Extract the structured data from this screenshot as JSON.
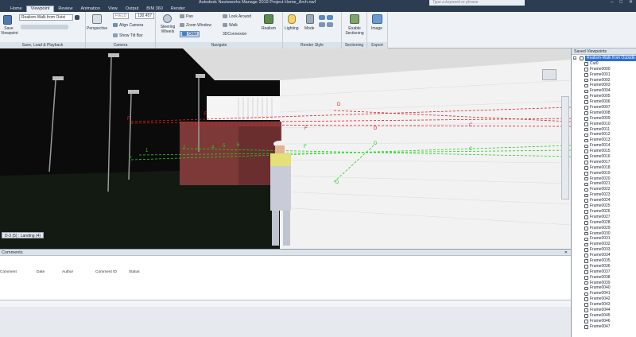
{
  "app": {
    "title": "Autodesk Navisworks Manage 2019    Project Home_Arch.nwf",
    "search_placeholder": "Type a keyword or phrase",
    "window_controls": [
      "–",
      "□",
      "✕"
    ]
  },
  "tabs": [
    "Home",
    "Viewpoint",
    "Review",
    "Animation",
    "View",
    "Output",
    "BIM 360",
    "Render"
  ],
  "active_tab": "Viewpoint",
  "ribbon": {
    "save_load": {
      "save_label": "Save\nViewpoint",
      "viewpoint_combo": "Realism-Walk from Outsi",
      "panel_title": "Save, Load & Playback"
    },
    "camera": {
      "perspective_label": "Perspective",
      "fov_value": "130.457",
      "fov_combo": "FIELD",
      "align_camera": "Align Camera",
      "show_tilt_bar": "Show Tilt Bar",
      "panel_title": "Camera"
    },
    "navigate": {
      "steering_wheels": "Steering\nWheels",
      "pan": "Pan",
      "zoom_window": "Zoom Window",
      "orbit": "Orbit",
      "look_around": "Look Around",
      "walk": "Walk",
      "connexion": "3DConnexion",
      "realism": "Realism",
      "panel_title": "Navigate"
    },
    "render_style": {
      "lighting": "Lighting",
      "mode": "Mode",
      "panel_title": "Render Style"
    },
    "sectioning": {
      "enable_sectioning": "Enable\nSectioning",
      "panel_title": "Sectioning"
    },
    "export": {
      "image": "Image",
      "panel_title": "Export"
    }
  },
  "viewport": {
    "view_label": "D-3 (5) : Landing (4)",
    "grid_labels": {
      "red": [
        "F",
        "F",
        "D",
        "D",
        "F",
        "C"
      ],
      "green": [
        "1",
        "2",
        "3",
        "4",
        "5",
        "6",
        "F",
        "F",
        "D",
        "D",
        "C"
      ]
    }
  },
  "comments": {
    "title": "Comments",
    "columns": [
      "Comment",
      "Date",
      "Author",
      "Comment ID",
      "Status"
    ]
  },
  "saved_viewpoints": {
    "title": "Saved Viewpoints",
    "items": [
      "Realism-Walk from Outside",
      "Cut0",
      "Frame0001",
      "Frame0002",
      "Frame0003",
      "Frame0004",
      "Frame0005",
      "Frame0006",
      "Frame0007",
      "Frame0008",
      "Frame0009",
      "Frame0010",
      "Frame0011",
      "Frame0012",
      "Frame0013",
      "Frame0014",
      "Frame0015",
      "Frame0016",
      "Frame0017",
      "Frame0018",
      "Frame0019",
      "Frame0020",
      "Frame0021",
      "Frame0022",
      "Frame0023",
      "Frame0024",
      "Frame0025",
      "Frame0026",
      "Frame0027",
      "Frame0028",
      "Frame0029",
      "Frame0030",
      "Frame0031",
      "Frame0032",
      "Frame0033",
      "Frame0034",
      "Frame0035",
      "Frame0036",
      "Frame0037",
      "Frame0038",
      "Frame0039",
      "Frame0040",
      "Frame0041",
      "Frame0042",
      "Frame0043",
      "Frame0044",
      "Frame0045",
      "Frame0046",
      "Frame0047"
    ],
    "root_label": "Frame0000",
    "selected": "Realism-Walk from Outside"
  },
  "colors": {
    "title_bar": "#2c3d52",
    "ribbon": "#eef2f6",
    "selection": "#2e6fd1",
    "grid_red": "#e02020",
    "grid_green": "#20d020",
    "brick": "#8a3a3a"
  }
}
